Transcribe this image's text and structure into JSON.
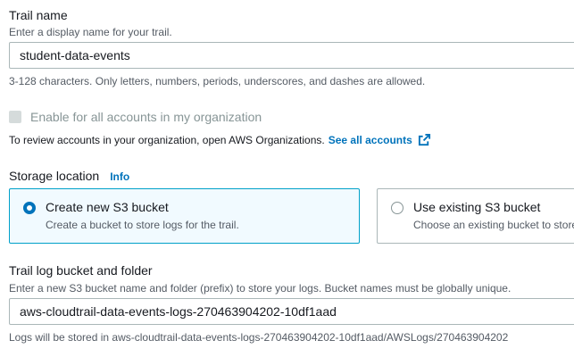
{
  "trail_name": {
    "label": "Trail name",
    "description": "Enter a display name for your trail.",
    "value": "student-data-events",
    "constraint": "3-128 characters. Only letters, numbers, periods, underscores, and dashes are allowed."
  },
  "organization": {
    "checkbox_label": "Enable for all accounts in my organization",
    "checked": false,
    "disabled": true,
    "review_text": "To review accounts in your organization, open AWS Organizations.",
    "link_text": "See all accounts"
  },
  "storage_location": {
    "label": "Storage location",
    "info_label": "Info",
    "options": [
      {
        "title": "Create new S3 bucket",
        "description": "Create a bucket to store logs for the trail.",
        "selected": true
      },
      {
        "title": "Use existing S3 bucket",
        "description": "Choose an existing bucket to store logs for this trail.",
        "selected": false
      }
    ]
  },
  "bucket": {
    "label": "Trail log bucket and folder",
    "description": "Enter a new S3 bucket name and folder (prefix) to store your logs. Bucket names must be globally unique.",
    "value": "aws-cloudtrail-data-events-logs-270463904202-10df1aad",
    "storage_path": "Logs will be stored in aws-cloudtrail-data-events-logs-270463904202-10df1aad/AWSLogs/270463904202"
  },
  "colors": {
    "link": "#0073bb",
    "selected_border": "#00a1c9",
    "selected_background": "#f1faff"
  }
}
